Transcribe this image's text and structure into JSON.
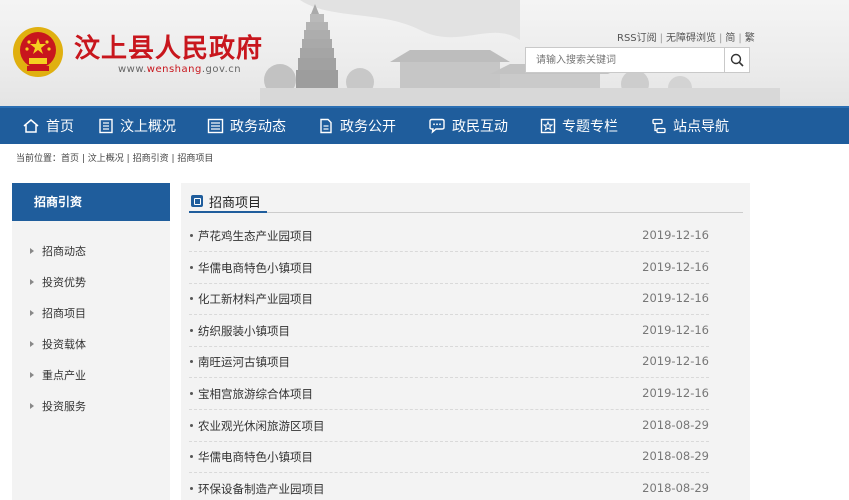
{
  "header": {
    "site_title": "汶上县人民政府",
    "site_url_prefix": "www.",
    "site_url_brand": "wenshang",
    "site_url_suffix": ".gov.cn",
    "top_links": [
      "RSS订阅",
      "无障碍浏览",
      "简",
      "繁"
    ],
    "search_placeholder": "请输入搜索关键词",
    "accent_color": "#c8161d"
  },
  "nav": {
    "items": [
      {
        "label": "首页",
        "icon": "home-icon"
      },
      {
        "label": "汶上概况",
        "icon": "document-list-icon"
      },
      {
        "label": "政务动态",
        "icon": "news-list-icon"
      },
      {
        "label": "政务公开",
        "icon": "file-icon"
      },
      {
        "label": "政民互动",
        "icon": "chat-icon"
      },
      {
        "label": "专题专栏",
        "icon": "star-icon"
      },
      {
        "label": "站点导航",
        "icon": "sitemap-icon"
      }
    ],
    "bg_color": "#1f5d9c"
  },
  "breadcrumb": {
    "prefix": "当前位置：",
    "path": [
      "首页",
      "汶上概况",
      "招商引资",
      "招商项目"
    ]
  },
  "sidebar": {
    "heading": "招商引资",
    "items": [
      "招商动态",
      "投资优势",
      "招商项目",
      "投资载体",
      "重点产业",
      "投资服务"
    ]
  },
  "main": {
    "title": "招商项目",
    "rows": [
      {
        "title": "芦花鸡生态产业园项目",
        "date": "2019-12-16"
      },
      {
        "title": "华儒电商特色小镇项目",
        "date": "2019-12-16"
      },
      {
        "title": "化工新材料产业园项目",
        "date": "2019-12-16"
      },
      {
        "title": "纺织服装小镇项目",
        "date": "2019-12-16"
      },
      {
        "title": "南旺运河古镇项目",
        "date": "2019-12-16"
      },
      {
        "title": "宝相宫旅游综合体项目",
        "date": "2019-12-16"
      },
      {
        "title": "农业观光休闲旅游区项目",
        "date": "2018-08-29"
      },
      {
        "title": "华儒电商特色小镇项目",
        "date": "2018-08-29"
      },
      {
        "title": "环保设备制造产业园项目",
        "date": "2018-08-29"
      }
    ]
  }
}
